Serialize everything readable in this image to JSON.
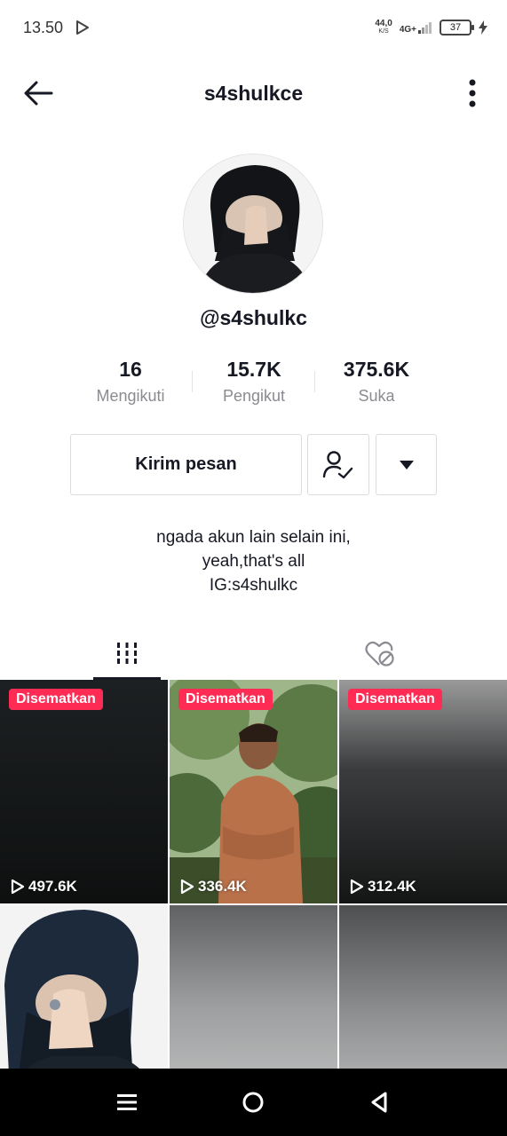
{
  "status_bar": {
    "time": "13.50",
    "speed": "44,0",
    "speed_unit": "K/S",
    "network": "4G+",
    "battery": "37"
  },
  "header": {
    "title": "s4shulkce"
  },
  "profile": {
    "handle": "@s4shulkc",
    "stats": [
      {
        "value": "16",
        "label": "Mengikuti"
      },
      {
        "value": "15.7K",
        "label": "Pengikut"
      },
      {
        "value": "375.6K",
        "label": "Suka"
      }
    ],
    "message_button": "Kirim pesan",
    "bio": [
      "ngada akun lain selain ini,",
      "yeah,that's all",
      "IG:s4shulkc"
    ]
  },
  "tabs": [
    {
      "icon": "grid-icon",
      "active": true
    },
    {
      "icon": "liked-hidden-icon",
      "active": false
    }
  ],
  "videos": [
    {
      "pinned_label": "Disematkan",
      "views": "497.6K"
    },
    {
      "pinned_label": "Disematkan",
      "views": "336.4K"
    },
    {
      "pinned_label": "Disematkan",
      "views": "312.4K"
    },
    {
      "pinned_label": "",
      "views": ""
    },
    {
      "pinned_label": "",
      "views": ""
    },
    {
      "pinned_label": "",
      "views": ""
    }
  ],
  "colors": {
    "accent_pin": "#fe2c55",
    "text_primary": "#161823",
    "text_secondary": "#8a8b91"
  }
}
